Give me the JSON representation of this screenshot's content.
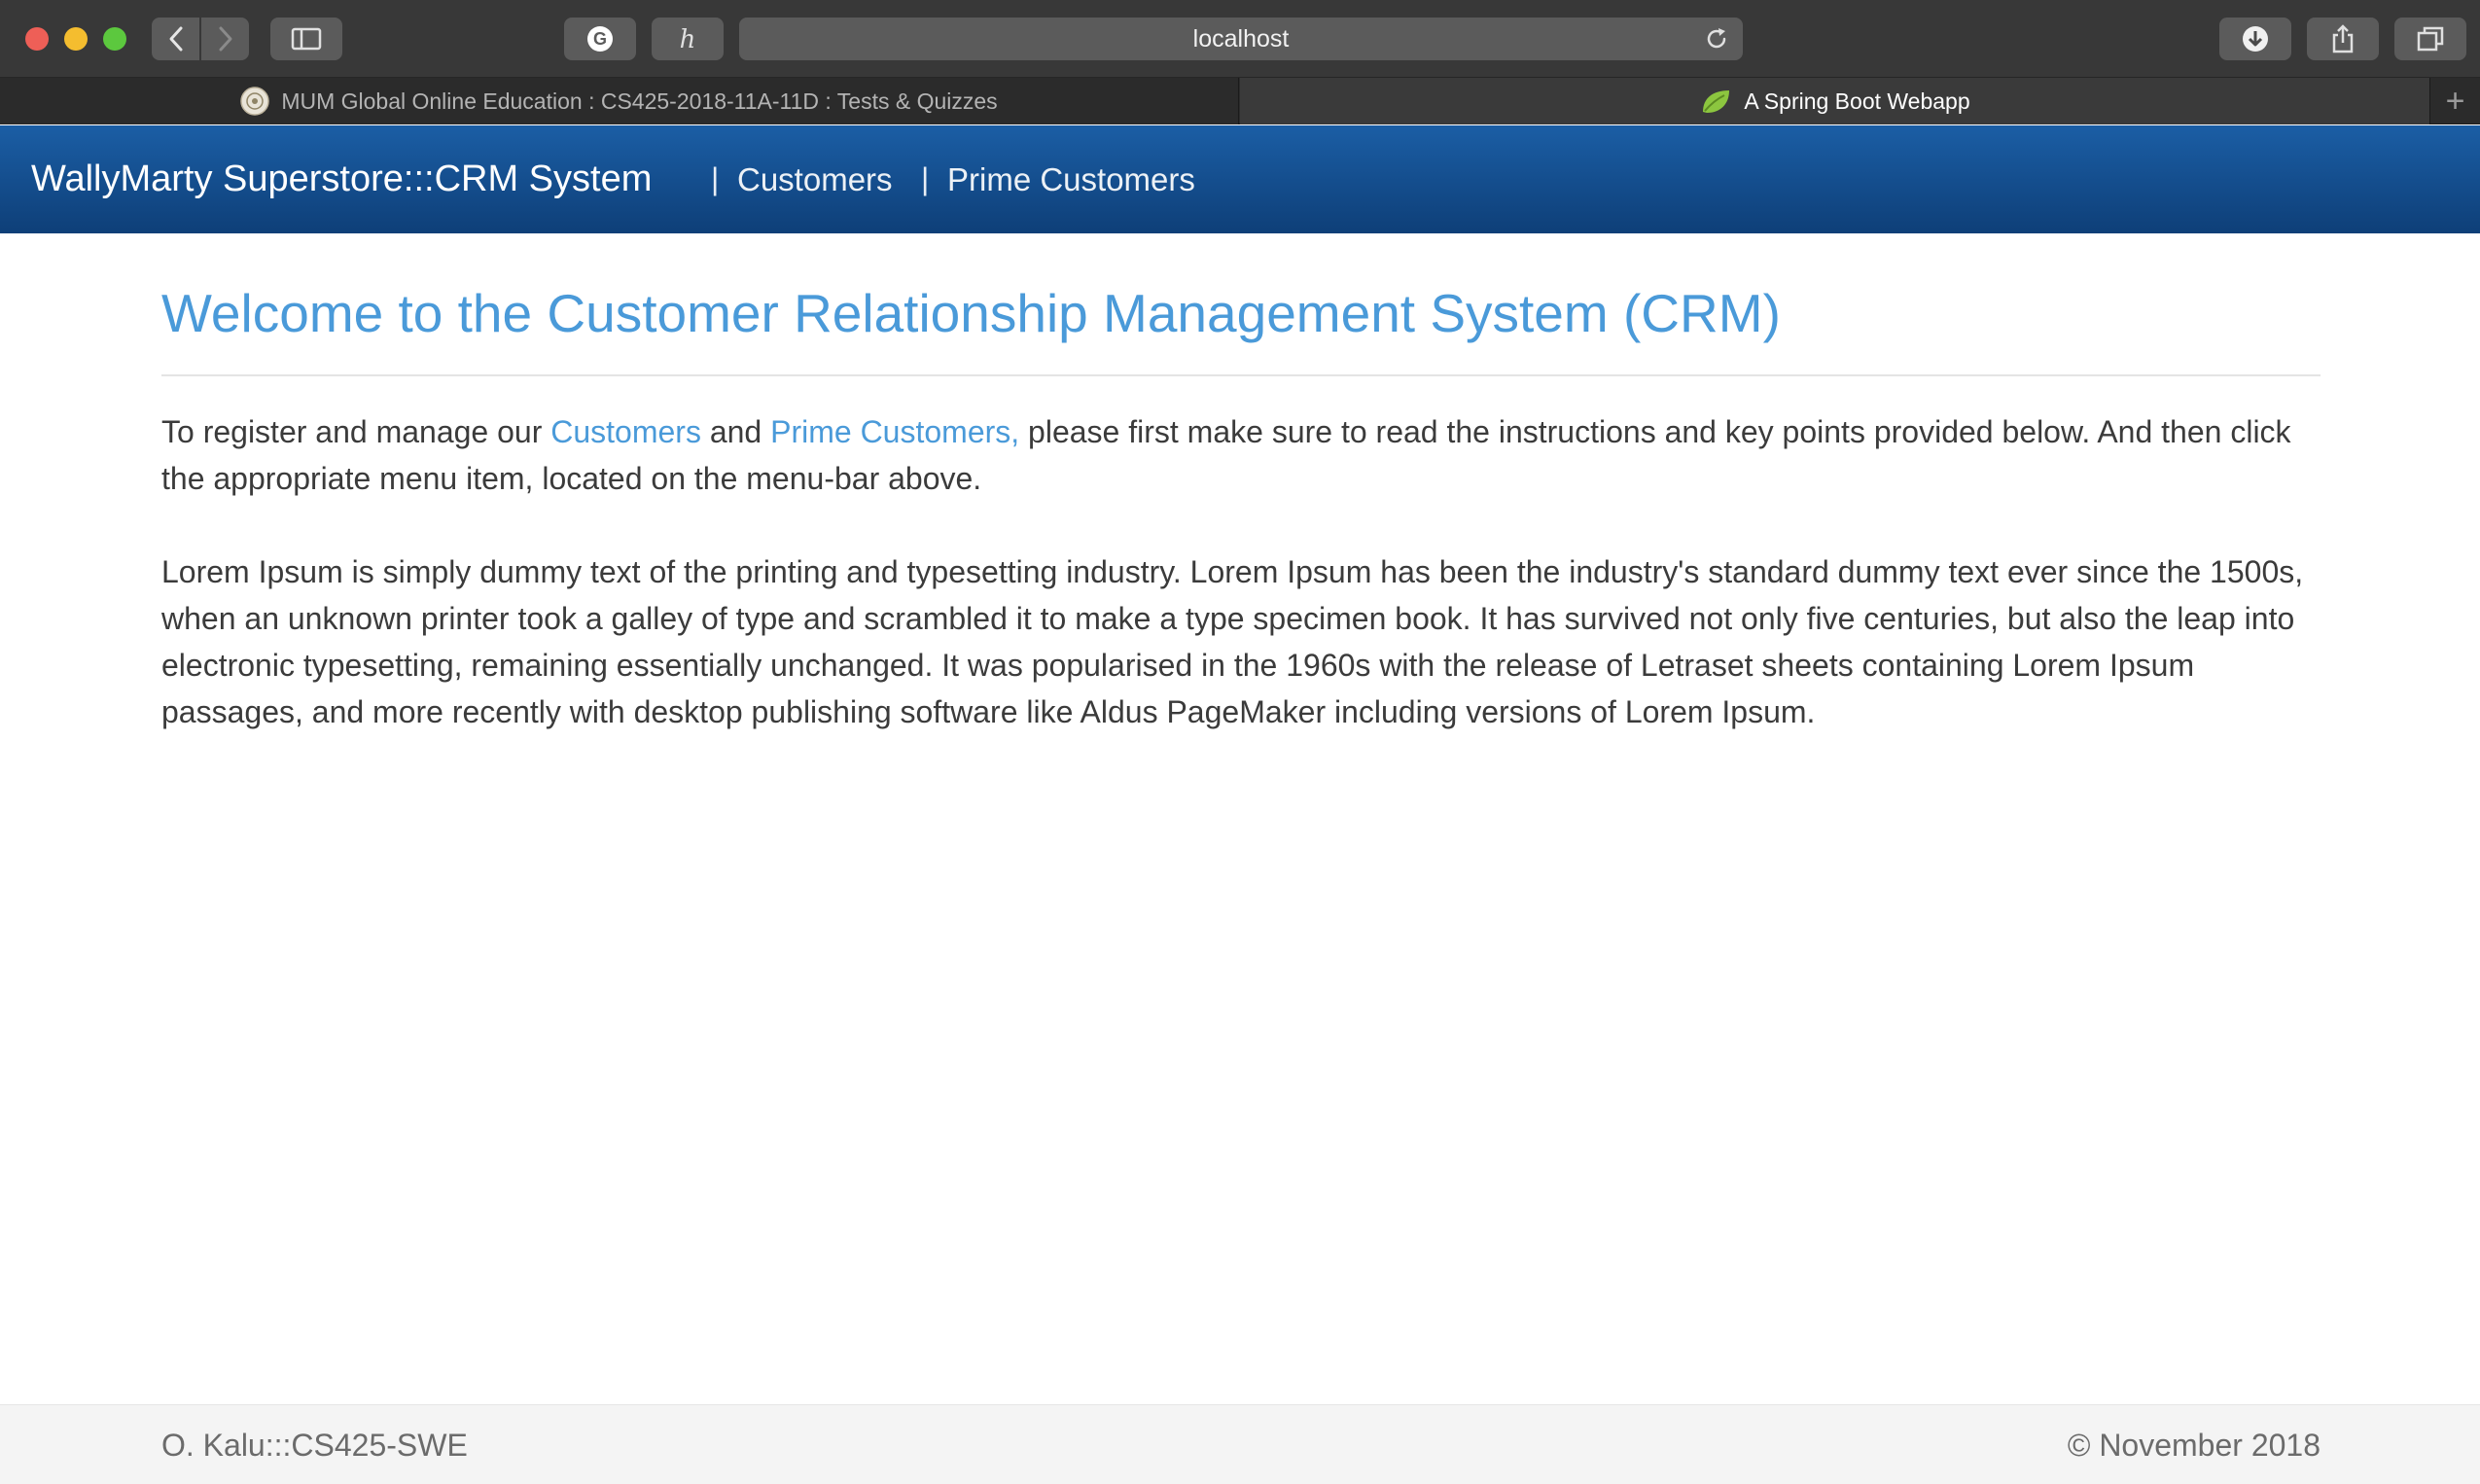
{
  "browser": {
    "address": "localhost",
    "tabs": [
      {
        "label": "MUM Global Online Education : CS425-2018-11A-11D : Tests & Quizzes",
        "active": false
      },
      {
        "label": "A Spring Boot Webapp",
        "active": true
      }
    ],
    "new_tab_label": "+"
  },
  "navbar": {
    "brand": "WallyMarty Superstore:::CRM System",
    "separator": "|",
    "links": [
      {
        "label": "Customers"
      },
      {
        "label": "Prime Customers"
      }
    ]
  },
  "main": {
    "heading": "Welcome to the Customer Relationship Management System (CRM)",
    "intro": {
      "before": "To register and manage our ",
      "link1": "Customers",
      "middle": " and ",
      "link2": "Prime Customers,",
      "after": " please first make sure to read the instructions and key points provided below. And then click the appropriate menu item, located on the menu-bar above."
    },
    "body": "Lorem Ipsum is simply dummy text of the printing and typesetting industry. Lorem Ipsum has been the industry's standard dummy text ever since the 1500s, when an unknown printer took a galley of type and scrambled it to make a type specimen book. It has survived not only five centuries, but also the leap into electronic typesetting, remaining essentially unchanged. It was popularised in the 1960s with the release of Letraset sheets containing Lorem Ipsum passages, and more recently with desktop publishing software like Aldus PageMaker including versions of Lorem Ipsum."
  },
  "footer": {
    "left": "O. Kalu:::CS425-SWE",
    "right": "© November 2018"
  },
  "colors": {
    "navbar_top": "#1b5ea5",
    "navbar_bottom": "#0e3f78",
    "accent_link": "#4a9ad9",
    "body_text": "#3b3b3b"
  },
  "icons": [
    "close-window-icon",
    "minimize-window-icon",
    "zoom-window-icon",
    "back-arrow-icon",
    "forward-arrow-icon",
    "sidebar-icon",
    "grammarly-icon",
    "honey-icon",
    "reload-icon",
    "download-icon",
    "share-icon",
    "tab-overview-icon",
    "mum-favicon",
    "spring-leaf-favicon"
  ]
}
